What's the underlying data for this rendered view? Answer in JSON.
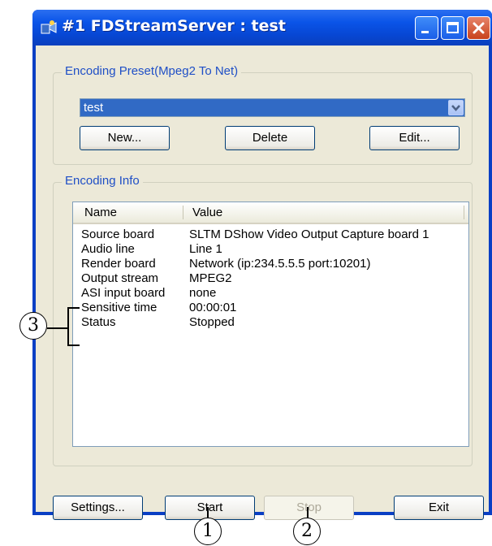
{
  "window": {
    "title": "#1 FDStreamServer : test",
    "icons": [
      "app-icon",
      "minimize-icon",
      "maximize-icon",
      "close-icon"
    ]
  },
  "preset_group": {
    "label": "Encoding Preset(Mpeg2 To Net)",
    "selected": "test",
    "buttons": {
      "new": "New...",
      "delete": "Delete",
      "edit": "Edit..."
    }
  },
  "info_group": {
    "label": "Encoding Info",
    "columns": [
      "Name",
      "Value"
    ],
    "rows": [
      {
        "name": "Source board",
        "value": "SLTM DShow  Video Output Capture board 1"
      },
      {
        "name": "Audio line",
        "value": "Line 1"
      },
      {
        "name": "Render board",
        "value": "Network (ip:234.5.5.5 port:10201)"
      },
      {
        "name": "Output stream",
        "value": "MPEG2"
      },
      {
        "name": "ASI input board",
        "value": "none"
      },
      {
        "name": "Sensitive time",
        "value": "00:00:01"
      },
      {
        "name": "Status",
        "value": "Stopped"
      }
    ]
  },
  "footer": {
    "settings": "Settings...",
    "start": "Start",
    "stop": "Stop",
    "exit": "Exit"
  },
  "callouts": {
    "one": "1",
    "two": "2",
    "three": "3"
  },
  "colors": {
    "titlebar": "#0a54e8",
    "selection": "#316ac5",
    "group_label": "#1f4fc6"
  }
}
